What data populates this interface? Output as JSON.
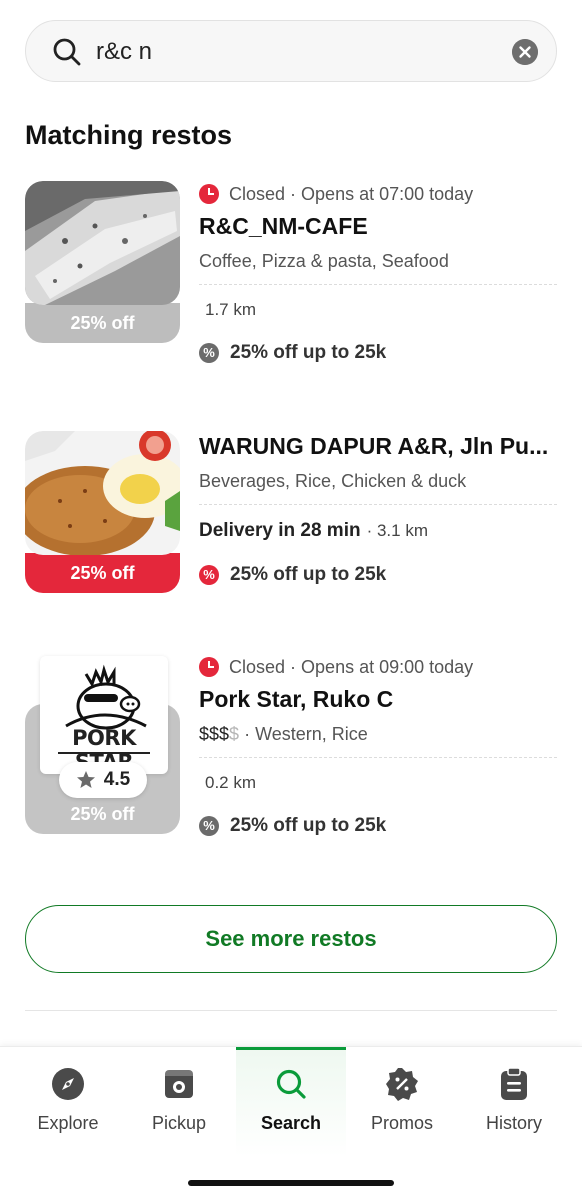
{
  "search": {
    "query": "r&c n"
  },
  "section_title": "Matching restos",
  "restos": [
    {
      "status": "Closed",
      "opens": "· Opens at 07:00 today",
      "name": "R&C_NM-CAFE",
      "cuisine": "Coffee, Pizza & pasta, Seafood",
      "distance": "1.7 km",
      "thumb_discount": "25% off",
      "promo": "25% off up to 25k"
    },
    {
      "name": "WARUNG DAPUR A&R, Jln Pu...",
      "cuisine": "Beverages, Rice, Chicken & duck",
      "delivery": "Delivery in 28 min",
      "distance": "· 3.1 km",
      "thumb_discount": "25% off",
      "promo": "25% off up to 25k"
    },
    {
      "status": "Closed",
      "opens": "· Opens at 09:00 today",
      "name": "Pork Star, Ruko C",
      "price_active": "$$$",
      "price_inactive": "$",
      "cuisine": "· Western, Rice",
      "distance": "0.2 km",
      "logo_text": "PORK STAR",
      "rating": "4.5",
      "thumb_discount": "25% off",
      "promo": "25% off up to 25k"
    }
  ],
  "see_more": "See more restos",
  "nav": [
    {
      "label": "Explore",
      "icon": "compass-icon"
    },
    {
      "label": "Pickup",
      "icon": "pickup-bag-icon"
    },
    {
      "label": "Search",
      "icon": "search-icon"
    },
    {
      "label": "Promos",
      "icon": "promo-percent-icon"
    },
    {
      "label": "History",
      "icon": "clipboard-icon"
    }
  ],
  "colors": {
    "accent_green": "#117a25",
    "nav_active": "#0a9b3a",
    "promo_red": "#e4273b",
    "discount_grey": "#bdbdbd"
  }
}
